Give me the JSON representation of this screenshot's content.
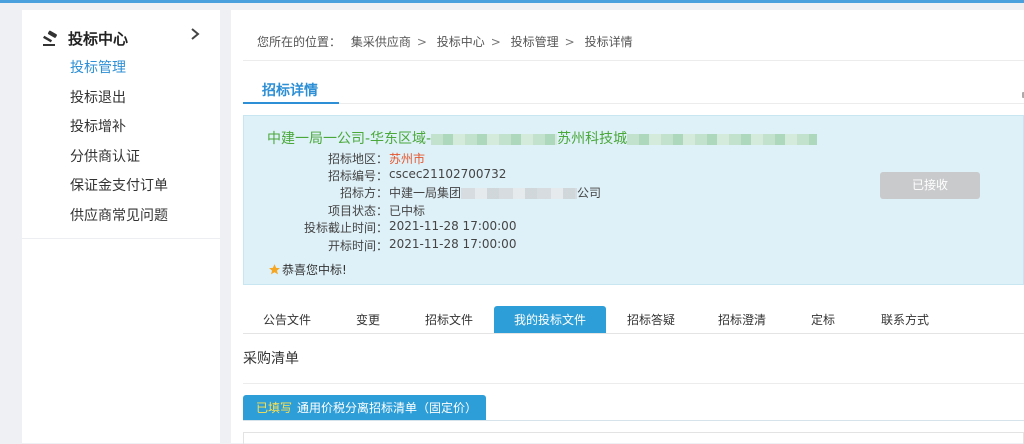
{
  "sidebar": {
    "title": "投标中心",
    "items": [
      {
        "label": "投标管理"
      },
      {
        "label": "投标退出"
      },
      {
        "label": "投标增补"
      },
      {
        "label": "分供商认证"
      },
      {
        "label": "保证金支付订单"
      },
      {
        "label": "供应商常见问题"
      }
    ]
  },
  "breadcrumb": {
    "prefix": "您所在的位置：",
    "parts": [
      "集采供应商",
      "投标中心",
      "投标管理",
      "投标详情"
    ],
    "separator": ">"
  },
  "page_tab": "招标详情",
  "card": {
    "title_start": "中建一局一公司-华东区域-",
    "title_middle": "苏州科技城",
    "rows": [
      {
        "label": "招标地区：",
        "value": "苏州市"
      },
      {
        "label": "招标编号：",
        "value": "cscec21102700732"
      },
      {
        "label": "招标方：",
        "value": "中建一局集团",
        "value_end": "公司"
      },
      {
        "label": "项目状态：",
        "value": "已中标"
      },
      {
        "label": "投标截止时间：",
        "value": "2021-11-28 17:00:00"
      },
      {
        "label": "开标时间：",
        "value": "2021-11-28 17:00:00"
      }
    ],
    "congrats": "恭喜您中标!",
    "status_button": "已接收"
  },
  "tabs": [
    {
      "label": "公告文件"
    },
    {
      "label": "变更"
    },
    {
      "label": "招标文件"
    },
    {
      "label": "我的投标文件"
    },
    {
      "label": "招标答疑"
    },
    {
      "label": "招标澄清"
    },
    {
      "label": "定标"
    },
    {
      "label": "联系方式"
    }
  ],
  "active_tab": "我的投标文件",
  "section_title": "采购清单",
  "sheet_tab": {
    "status": "已填写",
    "name": "通用价税分离招标清单（固定价）"
  },
  "colors": {
    "accent": "#2d9ed8",
    "project_title": "#4aa83a",
    "region": "#e4572e",
    "filled_tag": "#ffe24d",
    "top_line": "#4a9fdd"
  }
}
